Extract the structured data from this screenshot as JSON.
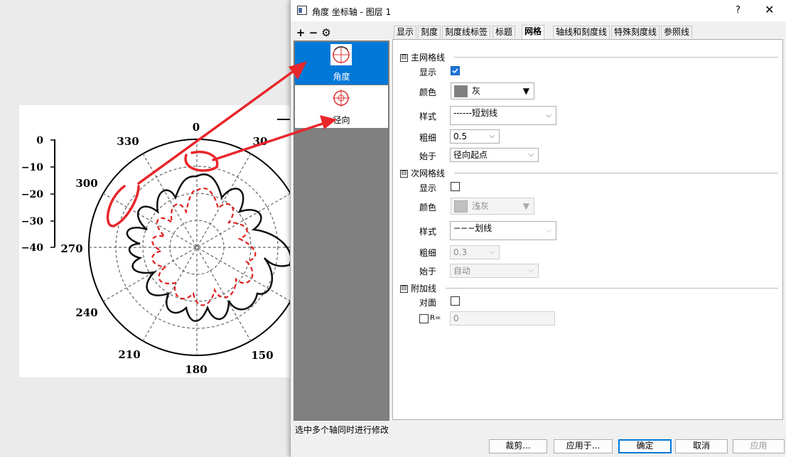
{
  "plot": {
    "angle_labels": [
      "0",
      "30",
      "150",
      "180",
      "210",
      "240",
      "270",
      "300",
      "330"
    ],
    "radial_labels": [
      "0",
      "−10",
      "−20",
      "−30",
      "−40"
    ],
    "line_colors": {
      "solid": "#111111",
      "dashed": "#e02020",
      "grid": "#666666",
      "annotation": "#e8262a"
    }
  },
  "dialog": {
    "title": "角度 坐标轴 - 图层 1",
    "help": "?",
    "close": "✕",
    "toolbar": {
      "add": "+",
      "remove": "−",
      "settings": "⚙"
    },
    "axes": [
      {
        "label": "角度",
        "selected": true
      },
      {
        "label": "径向",
        "selected": false
      }
    ],
    "tabs": [
      "显示",
      "刻度",
      "刻度线标签",
      "标题",
      "网格",
      "轴线和刻度线",
      "特殊刻度线",
      "参照线"
    ],
    "active_tab": "网格",
    "major": {
      "header": "主网格线",
      "show_label": "显示",
      "show_checked": true,
      "color_label": "颜色",
      "color_value": "灰",
      "color_hex": "#808080",
      "style_label": "样式",
      "style_value": "------短划线",
      "width_label": "粗细",
      "width_value": "0.5",
      "start_label": "始于",
      "start_value": "径向起点"
    },
    "minor": {
      "header": "次网格线",
      "show_label": "显示",
      "show_checked": false,
      "color_label": "颜色",
      "color_value": "浅灰",
      "color_hex": "#c0c0c0",
      "style_label": "样式",
      "style_value": "−−−划线",
      "width_label": "粗细",
      "width_value": "0.3",
      "start_label": "始于",
      "start_value": "自动"
    },
    "extra": {
      "header": "附加线",
      "opposite_label": "对面",
      "opposite_checked": false,
      "r_label": "R=",
      "r_value": "0"
    },
    "toggle_symbol": "⊟",
    "status": "选中多个轴同时进行修改",
    "buttons": {
      "crop": "裁剪...",
      "apply_to": "应用于...",
      "ok": "确定",
      "cancel": "取消",
      "apply": "应用"
    }
  }
}
